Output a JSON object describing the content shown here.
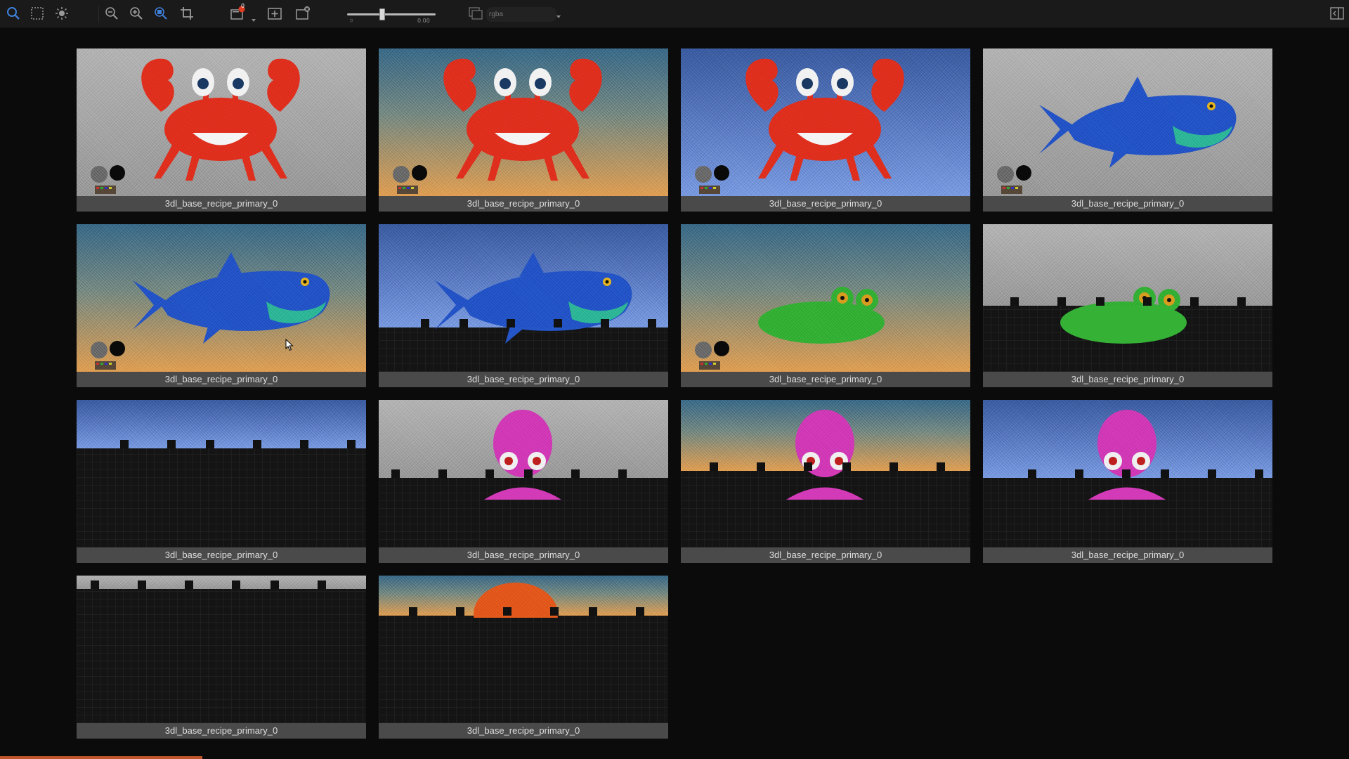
{
  "toolbar": {
    "icons": [
      "zoom-tool-icon",
      "marquee-select-icon",
      "exposure-icon",
      "zoom-out-icon",
      "zoom-in-icon",
      "zoom-fit-icon",
      "crop-icon",
      "snapshot-icon",
      "add-viewport-icon",
      "remove-viewport-icon",
      "channel-layers-icon",
      "panel-toggle-icon"
    ],
    "notification_badge": "0",
    "exposure_value": "0.00",
    "exposure_level": 0.4,
    "channel": "rgba"
  },
  "thumbnails": [
    {
      "caption": "3dl_base_recipe_primary_0",
      "subject": "crab",
      "bg": "gray",
      "visible_fraction": 1.0
    },
    {
      "caption": "3dl_base_recipe_primary_0",
      "subject": "crab",
      "bg": "orange",
      "visible_fraction": 1.0
    },
    {
      "caption": "3dl_base_recipe_primary_0",
      "subject": "crab",
      "bg": "blue",
      "visible_fraction": 1.0
    },
    {
      "caption": "3dl_base_recipe_primary_0",
      "subject": "shark",
      "bg": "gray",
      "visible_fraction": 1.0
    },
    {
      "caption": "3dl_base_recipe_primary_0",
      "subject": "shark",
      "bg": "orange",
      "visible_fraction": 1.0
    },
    {
      "caption": "3dl_base_recipe_primary_0",
      "subject": "shark",
      "bg": "blue",
      "visible_fraction": 0.7
    },
    {
      "caption": "3dl_base_recipe_primary_0",
      "subject": "frog",
      "bg": "orange",
      "visible_fraction": 1.0
    },
    {
      "caption": "3dl_base_recipe_primary_0",
      "subject": "frog",
      "bg": "gray",
      "visible_fraction": 0.55
    },
    {
      "caption": "3dl_base_recipe_primary_0",
      "subject": "none",
      "bg": "blue",
      "visible_fraction": 0.33
    },
    {
      "caption": "3dl_base_recipe_primary_0",
      "subject": "octopus",
      "bg": "gray",
      "visible_fraction": 0.53
    },
    {
      "caption": "3dl_base_recipe_primary_0",
      "subject": "octopus",
      "bg": "orange",
      "visible_fraction": 0.48
    },
    {
      "caption": "3dl_base_recipe_primary_0",
      "subject": "octopus",
      "bg": "blue",
      "visible_fraction": 0.53
    },
    {
      "caption": "3dl_base_recipe_primary_0",
      "subject": "none",
      "bg": "gray",
      "visible_fraction": 0.09
    },
    {
      "caption": "3dl_base_recipe_primary_0",
      "subject": "ball",
      "bg": "orange",
      "visible_fraction": 0.27
    }
  ],
  "render_progress": 0.15,
  "colors": {
    "gray_bg": "#a9a9a9",
    "orange_bg_top": "#3c6e8c",
    "orange_bg_bottom": "#e0a155",
    "blue_bg_top": "#3d5fa3",
    "blue_bg_bottom": "#7d9de0",
    "crab": "#e0301e",
    "shark": "#2456c8",
    "frog": "#35b236",
    "octopus": "#d23ab8",
    "progress": "#c0552a",
    "caption_bg": "#4a4a4a",
    "accent_icon": "#3f7fd9",
    "badge": "#e03a20"
  }
}
